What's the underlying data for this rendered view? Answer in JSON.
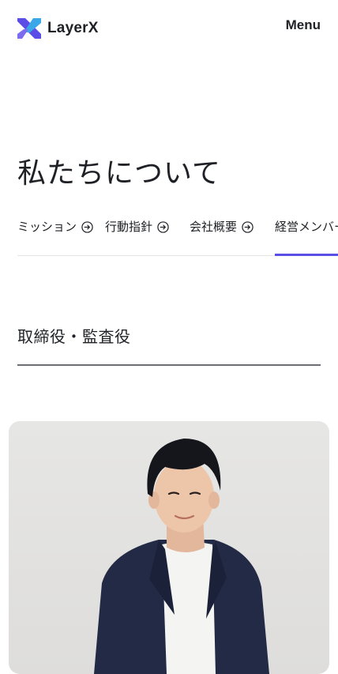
{
  "header": {
    "logo_text": "LayerX",
    "menu_label": "Menu"
  },
  "page": {
    "title": "私たちについて"
  },
  "tabs": [
    {
      "label": "ミッション",
      "icon": "arrow-circle-right-icon"
    },
    {
      "label": "行動指針",
      "icon": "arrow-circle-right-icon"
    },
    {
      "label": "会社概要",
      "icon": "arrow-circle-right-icon"
    },
    {
      "label": "経営メンバー",
      "active": true
    }
  ],
  "section": {
    "heading": "取締役・監査役"
  },
  "colors": {
    "accent": "#5b4ee6",
    "text": "#1f2126",
    "logo_purple": "#5b4ee6",
    "logo_blue": "#3aa8e8"
  }
}
